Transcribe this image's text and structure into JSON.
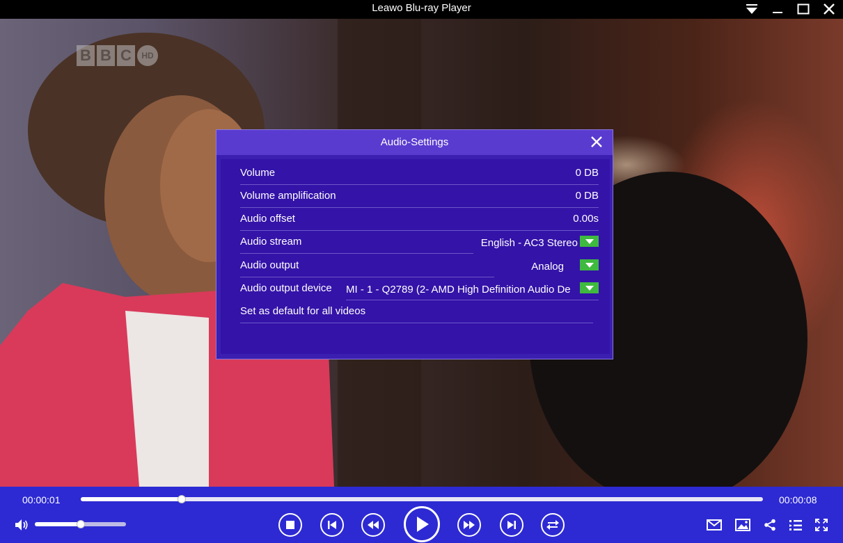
{
  "window": {
    "title": "Leawo Blu-ray Player",
    "buttons": [
      "menu",
      "minimize",
      "maximize",
      "close"
    ]
  },
  "video": {
    "channel_logo": [
      "B",
      "B",
      "C",
      "HD"
    ]
  },
  "dialog": {
    "title": "Audio-Settings",
    "rows": {
      "volume": {
        "label": "Volume",
        "value": "0 DB"
      },
      "amplification": {
        "label": "Volume amplification",
        "value": "0 DB"
      },
      "offset": {
        "label": "Audio offset",
        "value": "0.00s"
      },
      "stream": {
        "label": "Audio stream",
        "value": "English - AC3 Stereo"
      },
      "output": {
        "label": "Audio output",
        "value": "Analog"
      },
      "device": {
        "label": "Audio output device",
        "value": "MI - 1 - Q2789 (2- AMD High Definition Audio De"
      },
      "default": {
        "label": "Set as default for all videos"
      }
    }
  },
  "player": {
    "current_time": "00:00:01",
    "total_time": "00:00:08",
    "progress_fraction": 0.148,
    "volume_fraction": 0.5
  },
  "colors": {
    "dialog_bg": "#3b1fb0",
    "header_bg": "#5a3bd0",
    "controls_bg": "#2d2ad3",
    "dropdown_accent": "#3fb93f"
  },
  "icons": {
    "speaker": "speaker-icon",
    "stop": "stop-icon",
    "prev": "skip-previous-icon",
    "rewind": "rewind-icon",
    "play": "play-icon",
    "forward": "fast-forward-icon",
    "next": "skip-next-icon",
    "repeat": "repeat-icon",
    "mail": "mail-icon",
    "snapshot": "image-icon",
    "share": "share-icon",
    "playlist": "playlist-icon",
    "fullscreen": "fullscreen-icon"
  }
}
